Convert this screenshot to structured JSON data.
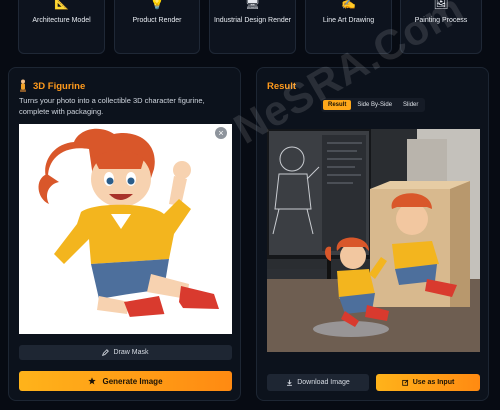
{
  "tiles": [
    {
      "label": "Architecture Model",
      "icon": "ruler-pencil-icon",
      "glyph": "📐"
    },
    {
      "label": "Product Render",
      "icon": "lightbulb-icon",
      "glyph": "💡"
    },
    {
      "label": "Industrial Design Render",
      "icon": "monitor-icon",
      "glyph": "🖥"
    },
    {
      "label": "Line Art Drawing",
      "icon": "hand-writing-icon",
      "glyph": "✍"
    },
    {
      "label": "Painting Process",
      "icon": "framed-picture-icon",
      "glyph": "🖼"
    }
  ],
  "left_panel": {
    "title": "3D Figurine",
    "title_icon": "figurine-icon",
    "description": "Turns your photo into a collectible 3D character figurine, complete with packaging.",
    "close_glyph": "×",
    "draw_mask_label": "Draw Mask",
    "generate_label": "Generate Image"
  },
  "right_panel": {
    "title": "Result",
    "tabs": [
      "Result",
      "Side By-Side",
      "Slider"
    ],
    "active_tab": "Result",
    "watermark": "NeSRA.Com",
    "download_label": "Download Image",
    "use_input_label": "Use as Input"
  },
  "colors": {
    "accent": "#ff9a1c",
    "background": "#070b13",
    "panel": "#0c121c"
  }
}
